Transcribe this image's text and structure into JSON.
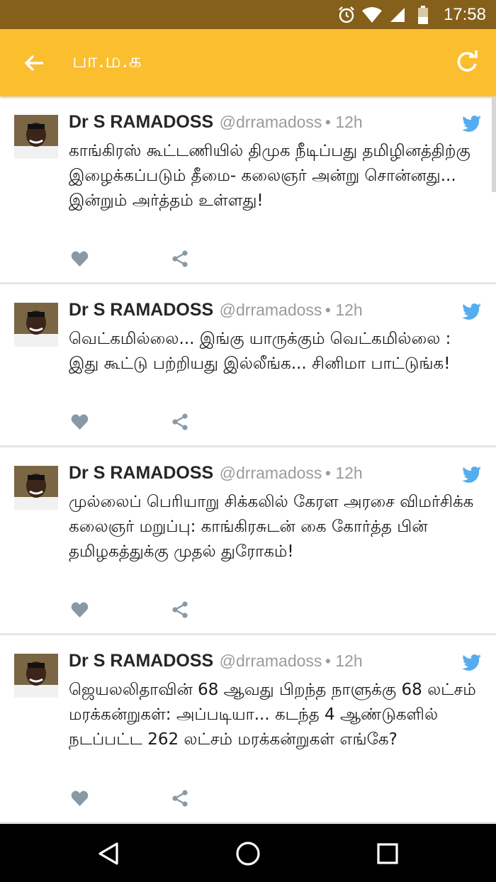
{
  "status_bar": {
    "time": "17:58",
    "icons": [
      "alarm-icon",
      "wifi-icon",
      "signal-icon",
      "battery-icon"
    ]
  },
  "app_bar": {
    "title": "பா.ம.க",
    "back_icon": "arrow-back-icon",
    "refresh_icon": "refresh-icon",
    "color": "#fbbe2f"
  },
  "tweets": [
    {
      "name": "Dr S RAMADOSS",
      "handle": "@drramadoss",
      "time": "• 12h",
      "text": "காங்கிரஸ் கூட்டணியில் திமுக நீடிப்பது தமிழினத்திற்கு இழைக்கப்படும் தீமை- கலைஞர் அன்று சொன்னது... இன்றும் அர்த்தம் உள்ளது!"
    },
    {
      "name": "Dr S RAMADOSS",
      "handle": "@drramadoss",
      "time": "• 12h",
      "text": "வெட்கமில்லை... இங்கு யாருக்கும் வெட்கமில்லை : இது கூட்டு பற்றியது இல்லீங்க... சினிமா பாட்டுங்க!"
    },
    {
      "name": "Dr S RAMADOSS",
      "handle": "@drramadoss",
      "time": "• 12h",
      "text": "முல்லைப் பெரியாறு சிக்கலில் கேரள அரசை விமர்சிக்க கலைஞர் மறுப்பு: காங்கிரசுடன் கை கோர்த்த பின் தமிழகத்துக்கு முதல் துரோகம்!"
    },
    {
      "name": "Dr S RAMADOSS",
      "handle": "@drramadoss",
      "time": "• 12h",
      "text": "ஜெயலலிதாவின் 68 ஆவது பிறந்த நாளுக்கு 68 லட்சம் மரக்கன்றுகள்: அப்படியா... கடந்த 4 ஆண்டுகளில் நடப்பட்ட 262 லட்சம் மரக்கன்றுகள் எங்கே?"
    }
  ],
  "nav_bar": {
    "buttons": [
      "back-triangle-icon",
      "home-circle-icon",
      "recents-square-icon"
    ]
  },
  "colors": {
    "status_bar": "#84601b",
    "twitter_blue": "#55acee",
    "action_gray": "#8899a6"
  }
}
